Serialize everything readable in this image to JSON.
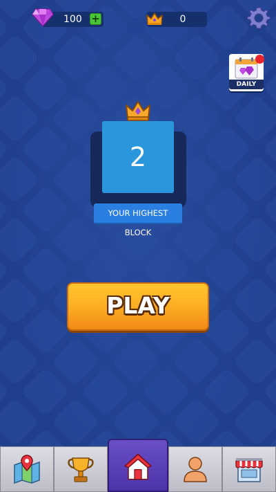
{
  "header": {
    "gems": "100",
    "gem_add_label": "+",
    "crowns": "0"
  },
  "daily": {
    "label": "DAILY"
  },
  "highest_block": {
    "value": "2",
    "label": "YOUR HIGHEST BLOCK"
  },
  "play_button": {
    "label": "PLAY"
  },
  "bottom_nav": {
    "items": [
      {
        "icon": "map-pin-icon",
        "active": false
      },
      {
        "icon": "trophy-icon",
        "active": false
      },
      {
        "icon": "home-icon",
        "active": true
      },
      {
        "icon": "profile-icon",
        "active": false
      },
      {
        "icon": "shop-icon",
        "active": false
      }
    ]
  },
  "colors": {
    "background": "#1f3f8c",
    "block": "#2a97dd",
    "play": "#fdb125",
    "active_tab": "#5a3fb8"
  }
}
